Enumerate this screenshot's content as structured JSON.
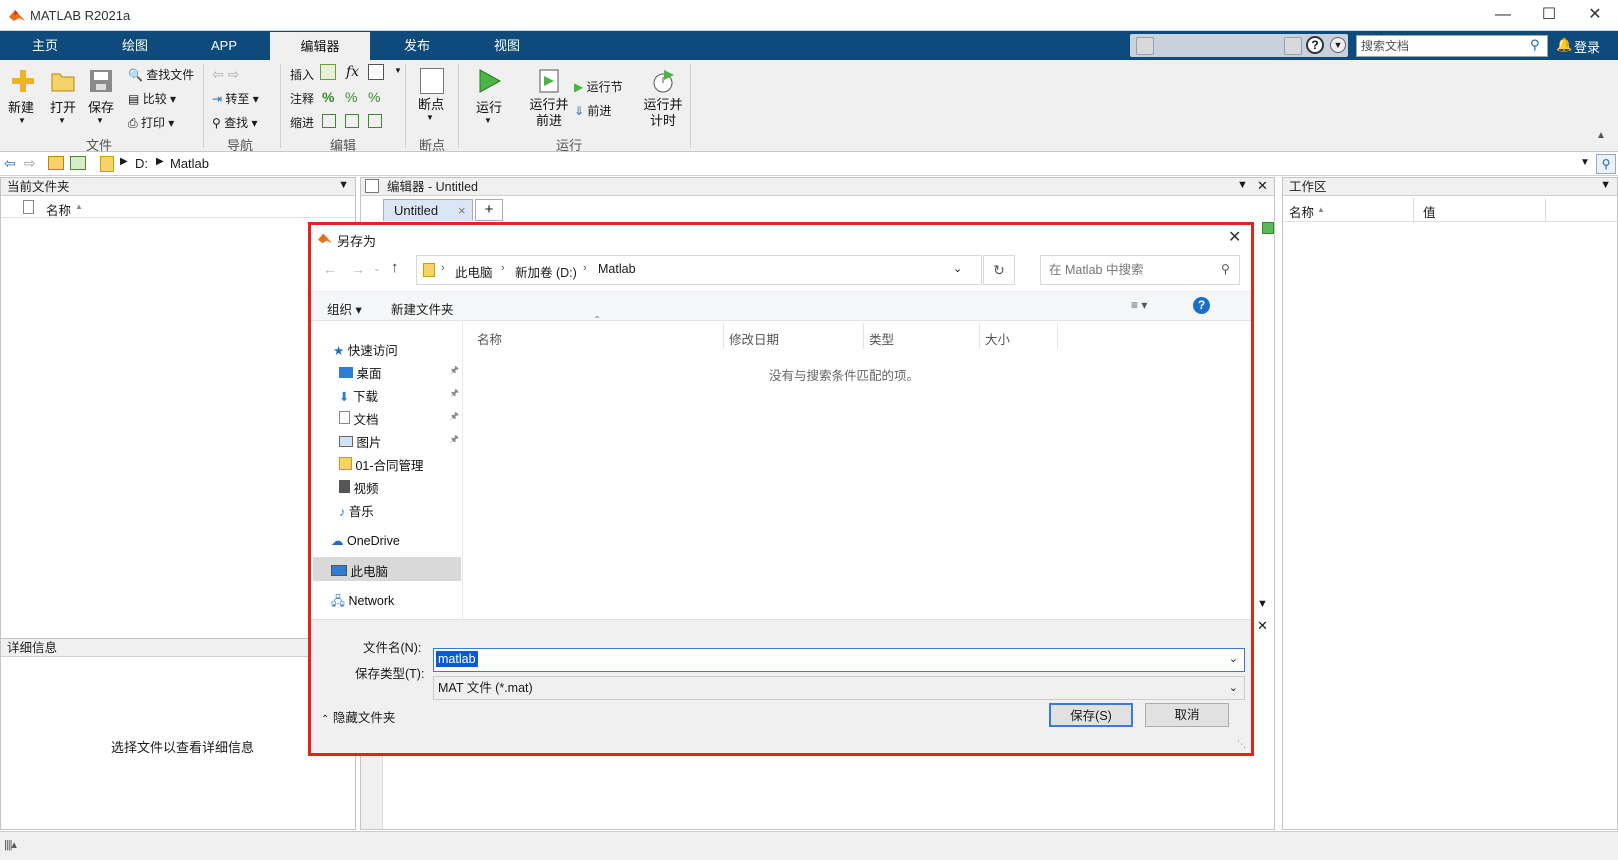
{
  "window": {
    "title": "MATLAB R2021a"
  },
  "ribbon": {
    "tabs": [
      "主页",
      "绘图",
      "APP",
      "编辑器",
      "发布",
      "视图"
    ],
    "search_placeholder": "搜索文档",
    "login_label": "登录",
    "file_group": {
      "new": "新建",
      "open": "打开",
      "save": "保存",
      "find_files": "查找文件",
      "compare": "比较",
      "print": "打印",
      "label": "文件"
    },
    "nav_group": {
      "goto": "转至",
      "find": "查找",
      "label": "导航"
    },
    "edit_group": {
      "insert": "插入",
      "comment": "注释",
      "indent": "缩进",
      "fx": "fx",
      "label": "编辑"
    },
    "breakpoint_group": {
      "breakpoints": "断点",
      "label": "断点"
    },
    "run_group": {
      "run": "运行",
      "run_advance": "运行并\n前进",
      "run_section": "运行节",
      "advance": "前进",
      "run_time": "运行并\n计时",
      "label": "运行"
    }
  },
  "address": {
    "drive": "D:",
    "folder": "Matlab"
  },
  "current_folder": {
    "title": "当前文件夹",
    "col_name": "名称"
  },
  "details": {
    "title": "详细信息",
    "hint": "选择文件以查看详细信息"
  },
  "editor": {
    "title": "编辑器 - Untitled",
    "tab": "Untitled",
    "add_tab": "+"
  },
  "workspace": {
    "title": "工作区",
    "col_name": "名称",
    "col_value": "值"
  },
  "dialog": {
    "title": "另存为",
    "breadcrumb": [
      "此电脑",
      "新加卷 (D:)",
      "Matlab"
    ],
    "search_placeholder": "在 Matlab 中搜索",
    "organize": "组织",
    "new_folder": "新建文件夹",
    "help": "?",
    "nav": {
      "quick_access": "快速访问",
      "items": [
        "桌面",
        "下载",
        "文档",
        "图片",
        "01-合同管理",
        "视频",
        "音乐"
      ],
      "onedrive": "OneDrive",
      "this_pc": "此电脑",
      "network": "Network"
    },
    "columns": [
      "名称",
      "修改日期",
      "类型",
      "大小"
    ],
    "empty_message": "没有与搜索条件匹配的项。",
    "filename_label": "文件名(N):",
    "filename_value": "matlab",
    "filetype_label": "保存类型(T):",
    "filetype_value": "MAT 文件 (*.mat)",
    "hide_folders": "隐藏文件夹",
    "save_button": "保存(S)",
    "cancel_button": "取消"
  },
  "colors": {
    "ribbon_blue": "#0e4a7b",
    "highlight_red": "#e0261b",
    "selection_blue": "#3b7bd6"
  }
}
